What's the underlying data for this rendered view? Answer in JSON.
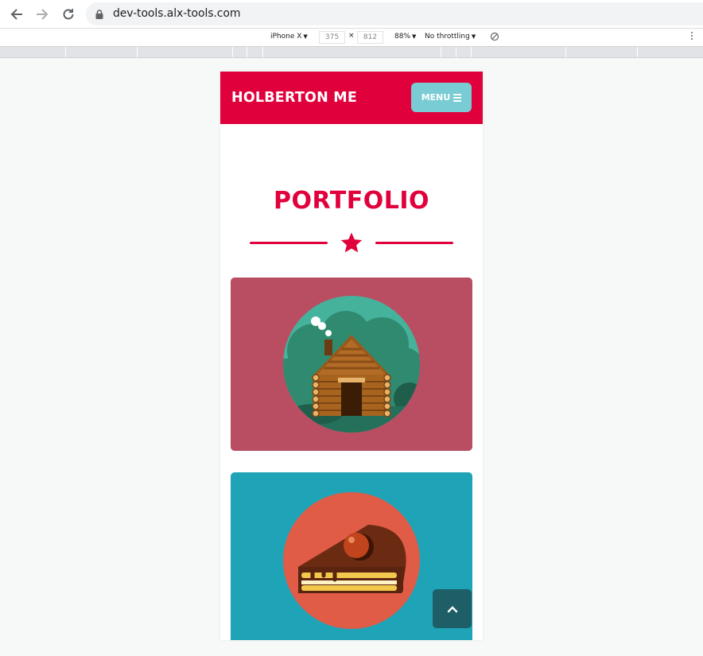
{
  "browser": {
    "url": "dev-tools.alx-tools.com",
    "device": "iPhone X",
    "width": "375",
    "height": "812",
    "zoom": "88%",
    "throttling": "No throttling",
    "times": "×"
  },
  "site": {
    "brand": "HOLBERTON ME",
    "menu_label": "MENU",
    "section_title": "PORTFOLIO",
    "portfolio": [
      {
        "image": "log-cabin-illustration",
        "background": "#b94e63"
      },
      {
        "image": "cake-slice-illustration",
        "background": "#1fa3b7"
      }
    ]
  },
  "colors": {
    "primary": "#e0013c",
    "menu_button": "#79ccd3",
    "back_to_top": "#1e5e66"
  },
  "icons": {
    "back": "back-arrow-icon",
    "forward": "forward-arrow-icon",
    "reload": "reload-icon",
    "lock": "lock-icon",
    "menu": "hamburger-icon",
    "star": "star-icon",
    "back_to_top": "chevron-up-icon"
  }
}
